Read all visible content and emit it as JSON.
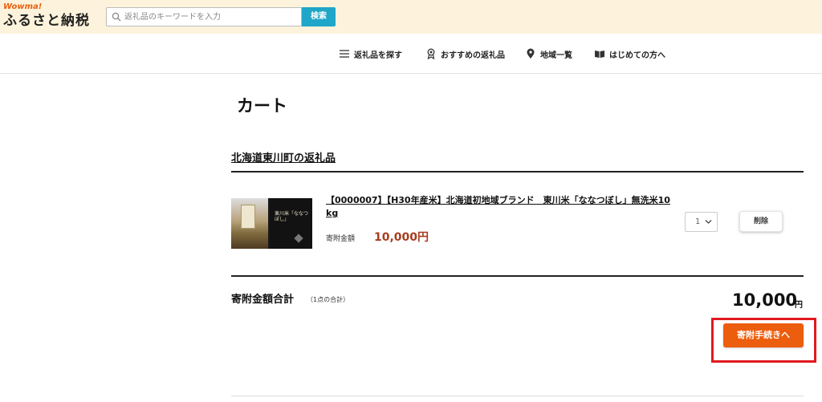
{
  "header": {
    "logo_small": "Wowma!",
    "logo_main": "ふるさと納税",
    "search_placeholder": "返礼品のキーワードを入力",
    "search_button": "検索"
  },
  "nav": {
    "items": [
      {
        "label": "返礼品を探す",
        "icon": "menu-icon"
      },
      {
        "label": "おすすめの返礼品",
        "icon": "award-icon"
      },
      {
        "label": "地域一覧",
        "icon": "map-pin-icon"
      },
      {
        "label": "はじめての方へ",
        "icon": "book-icon"
      }
    ]
  },
  "cart": {
    "title": "カート",
    "section_title": "北海道東川町の返礼品",
    "item": {
      "name": "【0000007】【H30年産米】北海道初地域ブランド　東川米「ななつぼし」無洗米10kg",
      "price_label": "寄附金額",
      "price": "10,000円",
      "quantity": "1",
      "delete_label": "削除",
      "thumb_text": "東川米「ななつぼし」"
    },
    "total_label": "寄附金額合計",
    "total_count": "（1点の合計）",
    "total_value": "10,000",
    "total_unit": "円",
    "proceed_label": "寄附手続きへ"
  },
  "colors": {
    "accent": "#ec5d0d",
    "search_button": "#1fa6c8",
    "price": "#a83c1e",
    "highlight": "#e0191f",
    "header_bg": "#fdf3dc"
  }
}
